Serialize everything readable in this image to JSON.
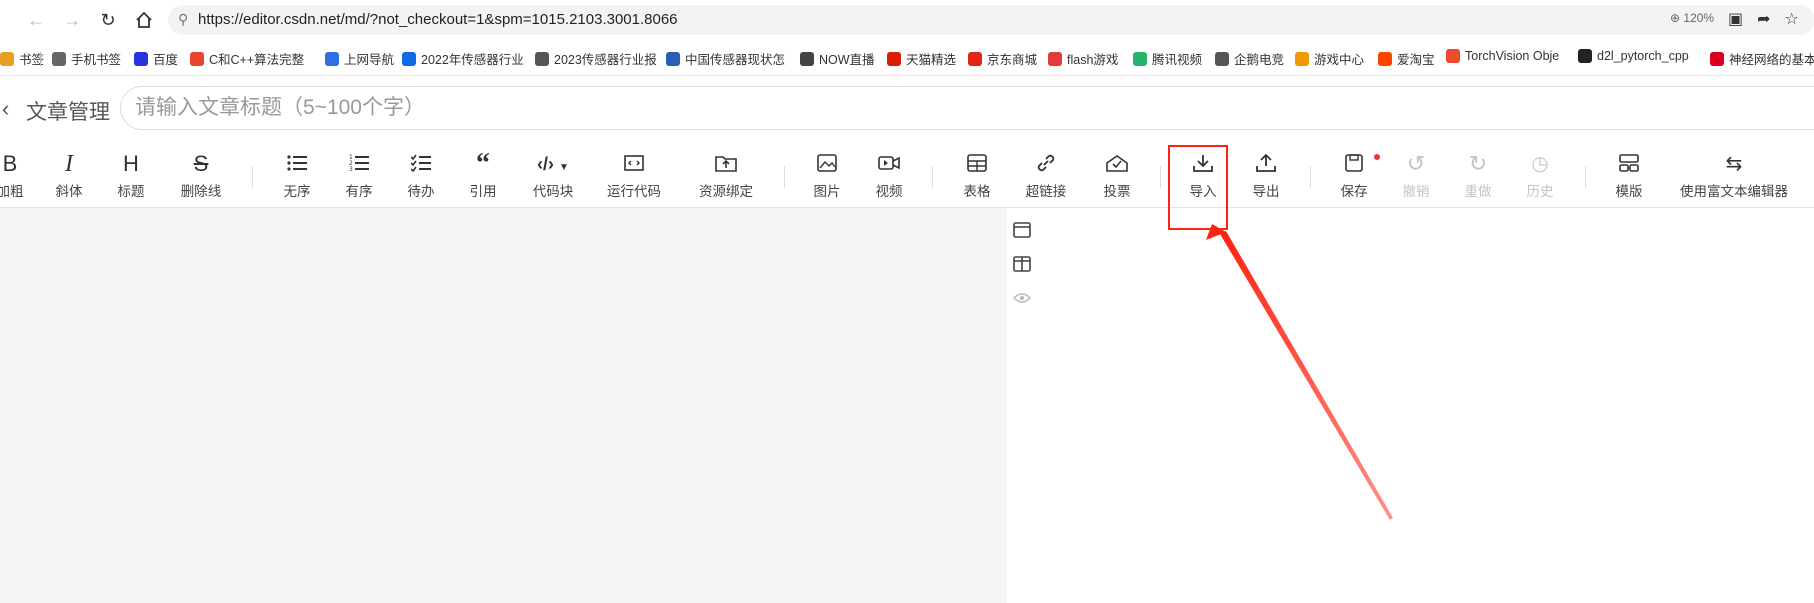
{
  "browser": {
    "url": "https://editor.csdn.net/md/?not_checkout=1&spm=1015.2103.3001.8066",
    "zoom": "120%",
    "nav_icons": [
      "back-icon",
      "forward-icon",
      "reload-icon",
      "home-icon"
    ]
  },
  "bookmarks": [
    {
      "label": "书签",
      "icon": "folder-icon",
      "color": "#e8a020"
    },
    {
      "label": "手机书签",
      "icon": "phone-icon",
      "color": "#666666"
    },
    {
      "label": "百度",
      "icon": "baidu-icon",
      "color": "#2932e1"
    },
    {
      "label": "C和C++算法完整",
      "icon": "c-icon",
      "color": "#e8452c"
    },
    {
      "label": "上网导航",
      "icon": "q-icon",
      "color": "#2f6fe4"
    },
    {
      "label": "2022年传感器行业",
      "icon": "zhi-icon",
      "color": "#0b6be8"
    },
    {
      "label": "2023传感器行业报",
      "icon": "globe-icon",
      "color": "#555555"
    },
    {
      "label": "中国传感器现状怎",
      "icon": "s-icon",
      "color": "#2b5fb5"
    },
    {
      "label": "NOW直播",
      "icon": "now-icon",
      "color": "#444444"
    },
    {
      "label": "天猫精选",
      "icon": "tmall-icon",
      "color": "#d81e06"
    },
    {
      "label": "京东商城",
      "icon": "jd-icon",
      "color": "#e1251b"
    },
    {
      "label": "flash游戏",
      "icon": "flash-icon",
      "color": "#e23b3b"
    },
    {
      "label": "腾讯视频",
      "icon": "tencent-video-icon",
      "color": "#26b36b"
    },
    {
      "label": "企鹅电竞",
      "icon": "penguin-icon",
      "color": "#555555"
    },
    {
      "label": "游戏中心",
      "icon": "gamepad-icon",
      "color": "#f39800"
    },
    {
      "label": "爱淘宝",
      "icon": "taobao-icon",
      "color": "#ff4400"
    },
    {
      "label": "TorchVision Obje",
      "icon": "torch-icon",
      "color": "#ee4c2c"
    },
    {
      "label": "d2l_pytorch_cpp",
      "icon": "github-icon",
      "color": "#222222"
    },
    {
      "label": "神经网络的基本",
      "icon": "51-icon",
      "color": "#d8001b"
    }
  ],
  "editor": {
    "back_label": "文章管理",
    "title_placeholder": "请输入文章标题（5~100个字）"
  },
  "toolbar": {
    "bold": "加粗",
    "italic": "斜体",
    "heading": "标题",
    "strike": "删除线",
    "unordered": "无序",
    "ordered": "有序",
    "todo": "待办",
    "quote": "引用",
    "codeblock": "代码块",
    "runcode": "运行代码",
    "resource": "资源绑定",
    "image": "图片",
    "video": "视频",
    "table": "表格",
    "link": "超链接",
    "vote": "投票",
    "import": "导入",
    "export": "导出",
    "save": "保存",
    "undo": "撤销",
    "redo": "重做",
    "history": "历史",
    "template": "模版",
    "richtext": "使用富文本编辑器"
  },
  "glyphs": {
    "bold": "B",
    "italic": "I",
    "heading": "H",
    "strike": "S"
  },
  "colors": {
    "annotation": "#ff2211",
    "save_dot": "#ee3333",
    "editor_bg": "#f5f5f5"
  }
}
